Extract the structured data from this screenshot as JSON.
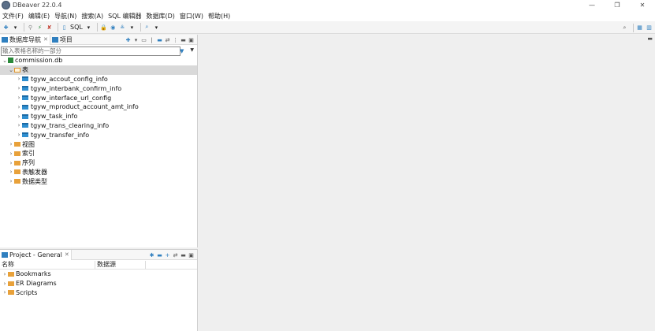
{
  "window": {
    "title": "DBeaver 22.0.4",
    "controls": [
      "—",
      "❐",
      "✕"
    ]
  },
  "menubar": {
    "items": [
      "文件(F)",
      "编辑(E)",
      "导航(N)",
      "搜索(A)",
      "SQL 编辑器",
      "数据库(D)",
      "窗口(W)",
      "帮助(H)"
    ]
  },
  "toolbar": {
    "sql_label": "SQL"
  },
  "navigator": {
    "tab_db": "数据库导航",
    "tab_projects": "项目",
    "filter_placeholder": "输入表格名称的一部分",
    "tree": {
      "root": "commission.db",
      "tables_folder": "表",
      "tables": [
        "tgyw_accout_config_info",
        "tgyw_interbank_confirm_info",
        "tgyw_interface_url_config",
        "tgyw_mproduct_account_amt_info",
        "tgyw_task_info",
        "tgyw_trans_clearing_info",
        "tgyw_transfer_info"
      ],
      "folders": [
        "视图",
        "索引",
        "序列",
        "表触发器",
        "数据类型"
      ]
    }
  },
  "project_panel": {
    "tab_label": "Project - General",
    "col_name": "名称",
    "col_datasource": "数据源",
    "items": [
      "Bookmarks",
      "ER Diagrams",
      "Scripts"
    ]
  },
  "colors": {
    "accent_blue": "#2f7fbf",
    "folder_orange": "#e8a13a",
    "db_green": "#2a8a3a"
  }
}
